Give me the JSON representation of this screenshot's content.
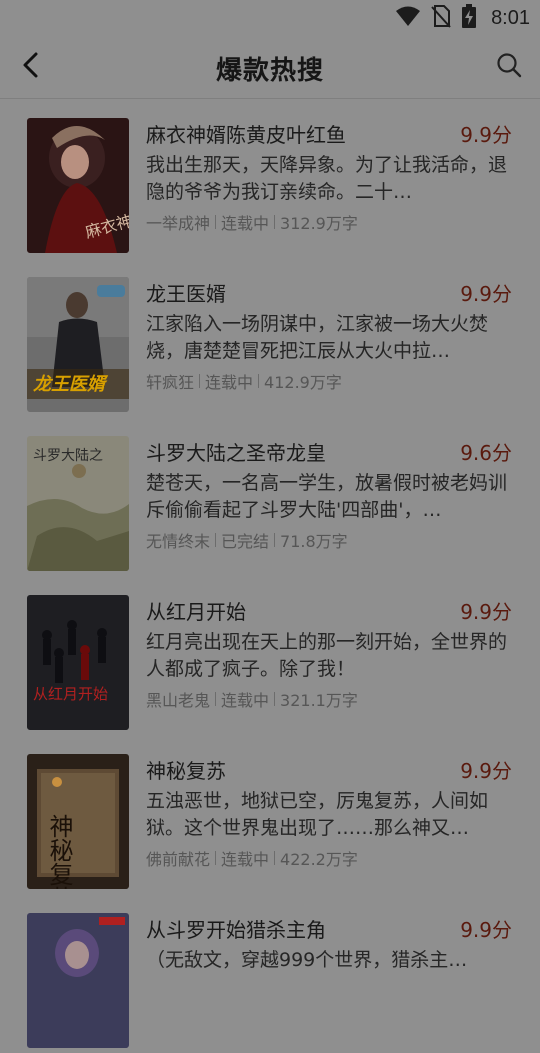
{
  "status_bar": {
    "time": "8:01",
    "icons": [
      "wifi-icon",
      "no-sim-icon",
      "battery-charging-icon"
    ]
  },
  "header": {
    "title": "爆款热搜",
    "back_icon": "back-arrow-icon",
    "search_icon": "search-icon"
  },
  "colors": {
    "overlay_background": "#8f8f8f",
    "score": "#5a1a0e",
    "meta_text": "#565656"
  },
  "books": [
    {
      "title": "麻衣神婿陈黄皮叶红鱼",
      "score": "9.9分",
      "desc": "我出生那天，天降异象。为了让我活命，退隐的爷爷为我订亲续命。二十…",
      "author": "一举成神",
      "status": "连载中",
      "words": "312.9万字",
      "cover_text": "麻衣神婿"
    },
    {
      "title": "龙王医婿",
      "score": "9.9分",
      "desc": "江家陷入一场阴谋中，江家被一场大火焚烧，唐楚楚冒死把江辰从大火中拉…",
      "author": "轩疯狂",
      "status": "连载中",
      "words": "412.9万字",
      "cover_text": "龙王医婿"
    },
    {
      "title": "斗罗大陆之圣帝龙皇",
      "score": "9.6分",
      "desc": "楚苍天，一名高一学生，放暑假时被老妈训斥偷偷看起了斗罗大陆'四部曲'，…",
      "author": "无情终末",
      "status": "已完结",
      "words": "71.8万字",
      "cover_text": "斗罗大陆之"
    },
    {
      "title": "从红月开始",
      "score": "9.9分",
      "desc": "红月亮出现在天上的那一刻开始，全世界的人都成了疯子。除了我！",
      "author": "黑山老鬼",
      "status": "连载中",
      "words": "321.1万字",
      "cover_text": "从红月开始"
    },
    {
      "title": "神秘复苏",
      "score": "9.9分",
      "desc": "五浊恶世，地狱已空，厉鬼复苏，人间如狱。这个世界鬼出现了……那么神又…",
      "author": "佛前献花",
      "status": "连载中",
      "words": "422.2万字",
      "cover_text": "神秘复苏"
    },
    {
      "title": "从斗罗开始猎杀主角",
      "score": "9.9分",
      "desc": "（无敌文，穿越999个世界，猎杀主…",
      "author": "",
      "status": "",
      "words": "",
      "cover_text": ""
    }
  ]
}
